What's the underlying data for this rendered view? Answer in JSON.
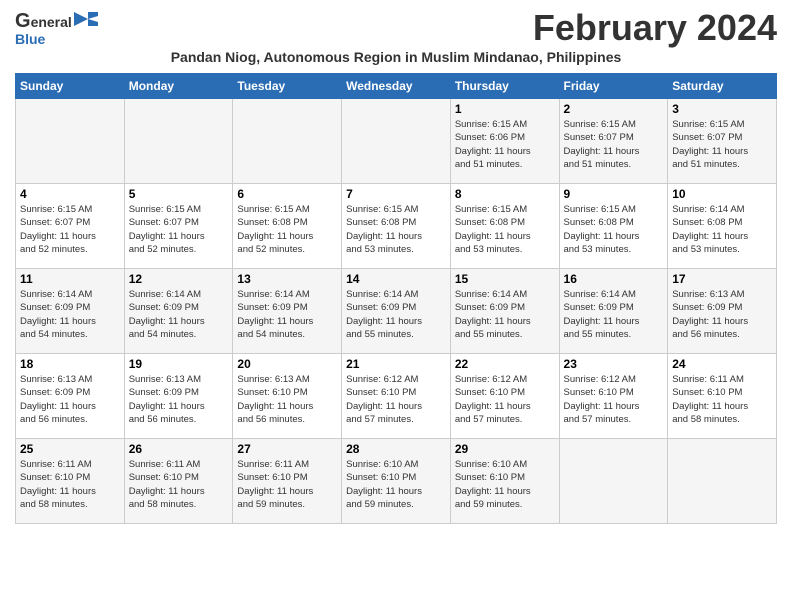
{
  "header": {
    "logo_general": "General",
    "logo_blue": "Blue",
    "month_title": "February 2024",
    "subtitle": "Pandan Niog, Autonomous Region in Muslim Mindanao, Philippines"
  },
  "weekdays": [
    "Sunday",
    "Monday",
    "Tuesday",
    "Wednesday",
    "Thursday",
    "Friday",
    "Saturday"
  ],
  "weeks": [
    [
      {
        "day": "",
        "info": ""
      },
      {
        "day": "",
        "info": ""
      },
      {
        "day": "",
        "info": ""
      },
      {
        "day": "",
        "info": ""
      },
      {
        "day": "1",
        "info": "Sunrise: 6:15 AM\nSunset: 6:06 PM\nDaylight: 11 hours\nand 51 minutes."
      },
      {
        "day": "2",
        "info": "Sunrise: 6:15 AM\nSunset: 6:07 PM\nDaylight: 11 hours\nand 51 minutes."
      },
      {
        "day": "3",
        "info": "Sunrise: 6:15 AM\nSunset: 6:07 PM\nDaylight: 11 hours\nand 51 minutes."
      }
    ],
    [
      {
        "day": "4",
        "info": "Sunrise: 6:15 AM\nSunset: 6:07 PM\nDaylight: 11 hours\nand 52 minutes."
      },
      {
        "day": "5",
        "info": "Sunrise: 6:15 AM\nSunset: 6:07 PM\nDaylight: 11 hours\nand 52 minutes."
      },
      {
        "day": "6",
        "info": "Sunrise: 6:15 AM\nSunset: 6:08 PM\nDaylight: 11 hours\nand 52 minutes."
      },
      {
        "day": "7",
        "info": "Sunrise: 6:15 AM\nSunset: 6:08 PM\nDaylight: 11 hours\nand 53 minutes."
      },
      {
        "day": "8",
        "info": "Sunrise: 6:15 AM\nSunset: 6:08 PM\nDaylight: 11 hours\nand 53 minutes."
      },
      {
        "day": "9",
        "info": "Sunrise: 6:15 AM\nSunset: 6:08 PM\nDaylight: 11 hours\nand 53 minutes."
      },
      {
        "day": "10",
        "info": "Sunrise: 6:14 AM\nSunset: 6:08 PM\nDaylight: 11 hours\nand 53 minutes."
      }
    ],
    [
      {
        "day": "11",
        "info": "Sunrise: 6:14 AM\nSunset: 6:09 PM\nDaylight: 11 hours\nand 54 minutes."
      },
      {
        "day": "12",
        "info": "Sunrise: 6:14 AM\nSunset: 6:09 PM\nDaylight: 11 hours\nand 54 minutes."
      },
      {
        "day": "13",
        "info": "Sunrise: 6:14 AM\nSunset: 6:09 PM\nDaylight: 11 hours\nand 54 minutes."
      },
      {
        "day": "14",
        "info": "Sunrise: 6:14 AM\nSunset: 6:09 PM\nDaylight: 11 hours\nand 55 minutes."
      },
      {
        "day": "15",
        "info": "Sunrise: 6:14 AM\nSunset: 6:09 PM\nDaylight: 11 hours\nand 55 minutes."
      },
      {
        "day": "16",
        "info": "Sunrise: 6:14 AM\nSunset: 6:09 PM\nDaylight: 11 hours\nand 55 minutes."
      },
      {
        "day": "17",
        "info": "Sunrise: 6:13 AM\nSunset: 6:09 PM\nDaylight: 11 hours\nand 56 minutes."
      }
    ],
    [
      {
        "day": "18",
        "info": "Sunrise: 6:13 AM\nSunset: 6:09 PM\nDaylight: 11 hours\nand 56 minutes."
      },
      {
        "day": "19",
        "info": "Sunrise: 6:13 AM\nSunset: 6:09 PM\nDaylight: 11 hours\nand 56 minutes."
      },
      {
        "day": "20",
        "info": "Sunrise: 6:13 AM\nSunset: 6:10 PM\nDaylight: 11 hours\nand 56 minutes."
      },
      {
        "day": "21",
        "info": "Sunrise: 6:12 AM\nSunset: 6:10 PM\nDaylight: 11 hours\nand 57 minutes."
      },
      {
        "day": "22",
        "info": "Sunrise: 6:12 AM\nSunset: 6:10 PM\nDaylight: 11 hours\nand 57 minutes."
      },
      {
        "day": "23",
        "info": "Sunrise: 6:12 AM\nSunset: 6:10 PM\nDaylight: 11 hours\nand 57 minutes."
      },
      {
        "day": "24",
        "info": "Sunrise: 6:11 AM\nSunset: 6:10 PM\nDaylight: 11 hours\nand 58 minutes."
      }
    ],
    [
      {
        "day": "25",
        "info": "Sunrise: 6:11 AM\nSunset: 6:10 PM\nDaylight: 11 hours\nand 58 minutes."
      },
      {
        "day": "26",
        "info": "Sunrise: 6:11 AM\nSunset: 6:10 PM\nDaylight: 11 hours\nand 58 minutes."
      },
      {
        "day": "27",
        "info": "Sunrise: 6:11 AM\nSunset: 6:10 PM\nDaylight: 11 hours\nand 59 minutes."
      },
      {
        "day": "28",
        "info": "Sunrise: 6:10 AM\nSunset: 6:10 PM\nDaylight: 11 hours\nand 59 minutes."
      },
      {
        "day": "29",
        "info": "Sunrise: 6:10 AM\nSunset: 6:10 PM\nDaylight: 11 hours\nand 59 minutes."
      },
      {
        "day": "",
        "info": ""
      },
      {
        "day": "",
        "info": ""
      }
    ]
  ]
}
